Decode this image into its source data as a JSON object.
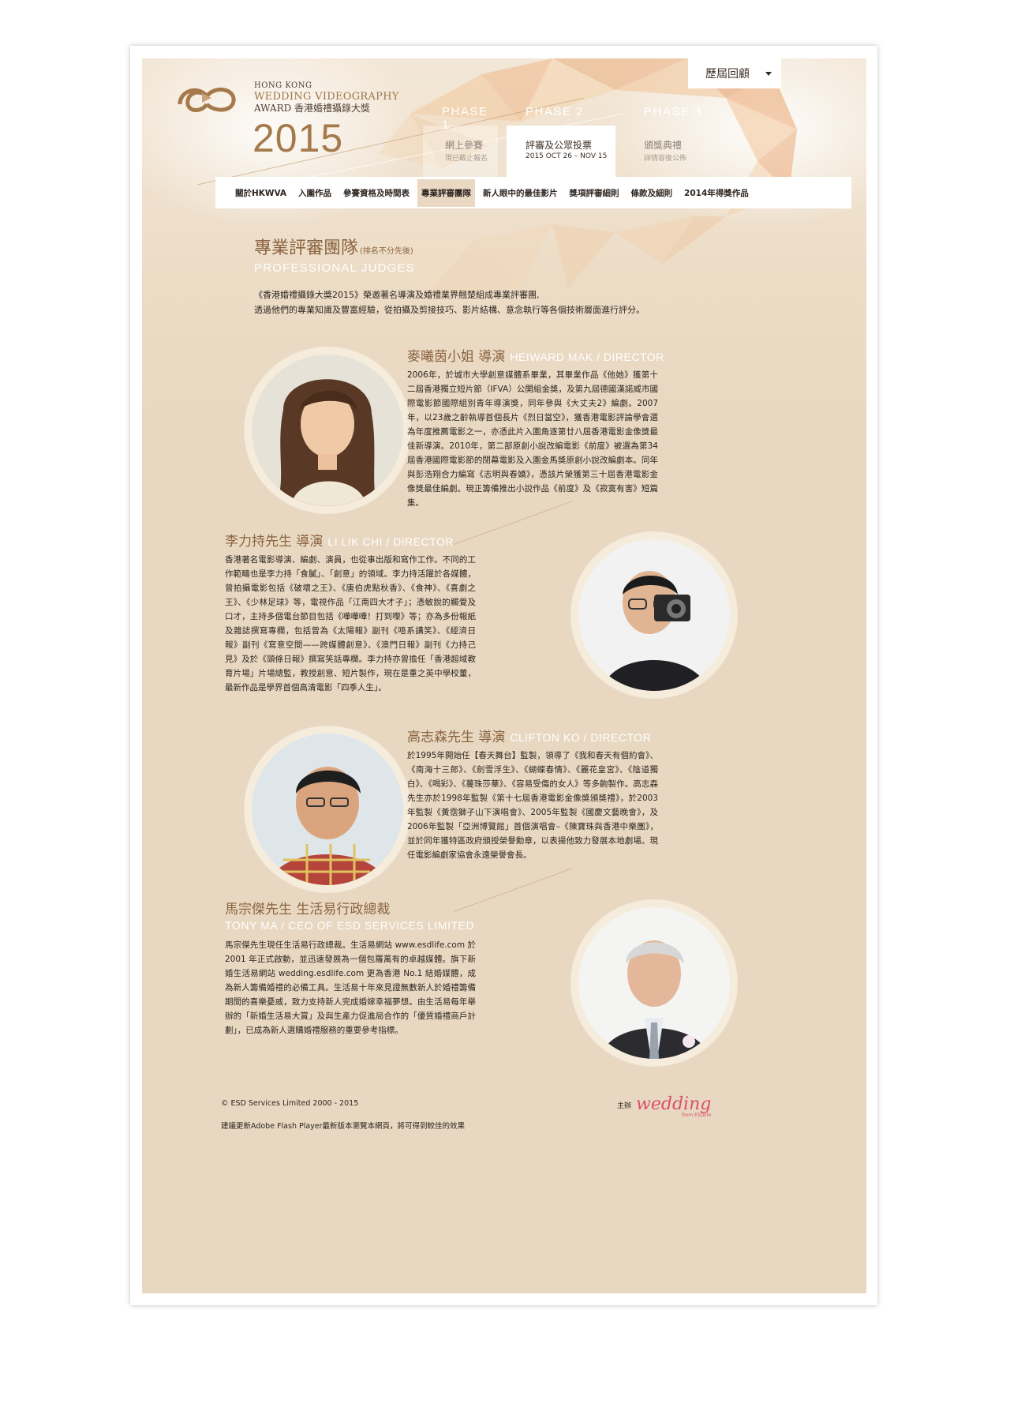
{
  "header": {
    "archive_select": "歷屆回顧",
    "logo_line1": "HONG KONG",
    "logo_line2": "WEDDING VIDEOGRAPHY",
    "logo_line3": "AWARD 香港婚禮攝錄大獎",
    "logo_year": "2015",
    "phases": [
      {
        "label": "PHASE 1",
        "title": "網上參賽",
        "sub": "現已截止報名"
      },
      {
        "label": "PHASE 2",
        "title": "評審及公眾投票",
        "sub": "2015 OCT 26 – NOV 15"
      },
      {
        "label": "PHASE 3",
        "title": "頒獎典禮",
        "sub": "詳情容後公佈"
      }
    ]
  },
  "nav": {
    "items": [
      "關於HKWVA",
      "入圍作品",
      "參賽資格及時間表",
      "專業評審團隊",
      "新人眼中的最佳影片",
      "獎項評審細則",
      "條款及細則",
      "2014年得獎作品"
    ],
    "active": "專業評審團隊"
  },
  "section": {
    "title": "專業評審團隊",
    "title_note": "(排名不分先後)",
    "subtitle": "PROFESSIONAL JUDGES",
    "intro_line1": "《香港婚禮攝錄大獎2015》榮邀著名導演及婚禮業界翹楚組成專業評審團,",
    "intro_line2": "透過他們的專業知識及豐富經驗，從拍攝及剪接技巧、影片結構、意念執行等各個技術層面進行評分。"
  },
  "judges": [
    {
      "name": "麥曦茵小姐 導演",
      "en": "HEIWARD MAK / DIRECTOR",
      "bio": "2006年，於城市大學創意媒體系畢業，其畢業作品《他她》獲第十二屆香港獨立短片節（IFVA）公開組金獎，及第九屆德國漢諾威市國際電影節國際組別青年導演獎，同年參與《大丈夫2》編劇。2007年，以23歲之齡執導首個長片《烈日當空》，獲香港電影評論學會選為年度推薦電影之一，亦憑此片入圍角逐第廿八屆香港電影金像獎最佳新導演。2010年，第二部原創小說改編電影《前度》被選為第34屆香港國際電影節的閉幕電影及入圍金馬獎原創小說改編劇本。同年與彭浩翔合力編寫《志明與春嬌》，憑該片榮獲第三十屆香港電影金像獎最佳編劇。現正籌備推出小說作品《前度》及《寂寞有害》短篇集。"
    },
    {
      "name": "李力持先生 導演",
      "en": "LI LIK CHI / DIRECTOR",
      "bio": "香港著名電影導演、編劇、演員，也從事出版和寫作工作。不同的工作範疇也是李力持「食膩」、「創意」的領域。李力持活躍於各媒體，曾拍攝電影包括《破壞之王》、《唐伯虎點秋香》、《食神》、《喜劇之王》、《少林足球》等，電視作品「江南四大才子」；憑敏銳的觸覺及口才，主持多個電台節目包括《嘩嘩嘩！打到嚟》等；亦為多份報紙及雜誌撰寫專欄，包括曾為《太陽報》副刊《唔系講笑》、《經濟日報》副刊《寫意空間——跨媒體創意》、《澳門日報》副刊《力持己見》及於《頭條日報》撰寫笑話專欄。李力持亦曾擔任「香港超域教育片場」片場總監，教授創意、短片製作，現在是重之英中學校董，最新作品是學界首個高清電影「四季人生」。"
    },
    {
      "name": "高志森先生 導演",
      "en": "CLIFTON KO / DIRECTOR",
      "bio": "於1995年開始任【春天舞台】監製，領導了《我和春天有個約會》、《南海十三郎》、《劍雪浮生》、《蝴蝶春情》、《麗花皇宮》、《陰道獨白》、《喝彩》、《蔓珠莎華》、《容易受傷的女人》等多齣製作。高志森先生亦於1998年監製《第十七屆香港電影金像獎頒獎禮》，於2003年監製《黃霑獅子山下演唱會》、2005年監製《國慶文藝晚會》，及2006年監製「亞洲博覽館」首個演唱會–《陳寶珠與香港中樂團》，並於同年獲特區政府頒授榮譽勳章，以表揚他致力發展本地劇場。現任電影編劇家協會永遠榮譽會長。"
    },
    {
      "name": "馬宗傑先生 生活易行政總裁",
      "en": "TONY MA / CEO OF ESD SERVICES LIMITED",
      "bio": "馬宗傑先生現任生活易行政總裁。生活易網站 www.esdlife.com 於 2001 年正式啟動，並迅速發展為一個包羅萬有的卓越媒體。旗下新婚生活易網站 wedding.esdlife.com 更為香港 No.1 結婚媒體，成為新人籌備婚禮的必備工具。生活易十年來見證無數新人於婚禮籌備期間的喜樂憂戚，致力支持新人完成婚嫁幸福夢想。由生活易每年舉辦的「新婚生活易大賞」及與生產力促進局合作的「優質婚禮商戶計劃」，已成為新人選購婚禮服務的重要參考指標。"
    }
  ],
  "footer": {
    "copyright": "© ESD Services Limited 2000 - 2015",
    "flash_note": "建議更新Adobe Flash Player最新版本瀏覽本網頁，將可得到較佳的效果",
    "sponsor_label": "主辦",
    "sponsor_brand": "wedding",
    "sponsor_brand_sub": "from ESDlife"
  },
  "colors": {
    "accent": "#8a6441",
    "background": "#e8d8c1",
    "sponsor": "#d9506a"
  }
}
